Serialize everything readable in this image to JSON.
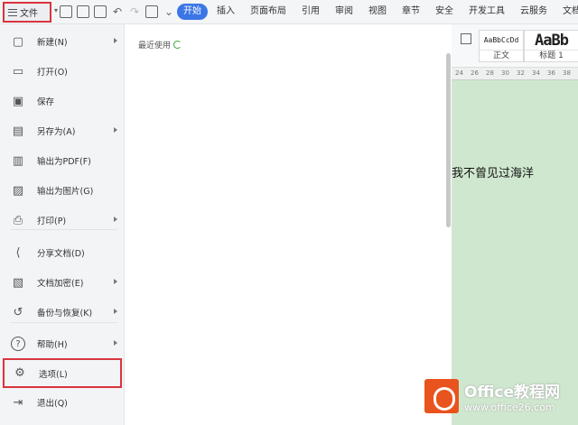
{
  "topbar": {
    "file_label": "文件",
    "tabs": [
      "开始",
      "插入",
      "页面布局",
      "引用",
      "审阅",
      "视图",
      "章节",
      "安全",
      "开发工具",
      "云服务",
      "文档助手"
    ]
  },
  "ribbon": {
    "styles": [
      {
        "sample": "AaBbCcDd",
        "label": "正文"
      },
      {
        "sample": "AaBb",
        "label": "标题 1"
      }
    ]
  },
  "ruler": {
    "ticks": [
      "24",
      "26",
      "28",
      "30",
      "32",
      "34",
      "36",
      "38"
    ]
  },
  "document": {
    "text": "我不曾见过海洋"
  },
  "menu": {
    "items": [
      {
        "label": "新建(N)",
        "icon": "new-file-icon",
        "arrow": true
      },
      {
        "label": "打开(O)",
        "icon": "folder-open-icon",
        "arrow": false
      },
      {
        "label": "保存",
        "icon": "save-icon",
        "arrow": false
      },
      {
        "label": "另存为(A)",
        "icon": "save-as-icon",
        "arrow": true
      },
      {
        "label": "输出为PDF(F)",
        "icon": "export-pdf-icon",
        "arrow": false
      },
      {
        "label": "输出为图片(G)",
        "icon": "export-image-icon",
        "arrow": false
      },
      {
        "label": "打印(P)",
        "icon": "printer-icon",
        "arrow": true
      },
      {
        "label": "分享文档(D)",
        "icon": "share-icon",
        "arrow": false
      },
      {
        "label": "文档加密(E)",
        "icon": "encrypt-icon",
        "arrow": true
      },
      {
        "label": "备份与恢复(K)",
        "icon": "backup-icon",
        "arrow": true
      },
      {
        "label": "帮助(H)",
        "icon": "help-icon",
        "arrow": true
      },
      {
        "label": "选项(L)",
        "icon": "gear-icon",
        "arrow": false
      },
      {
        "label": "退出(Q)",
        "icon": "exit-icon",
        "arrow": false
      }
    ]
  },
  "recent": {
    "title": "最近使用"
  },
  "watermark": {
    "brand": "Office教程网",
    "url": "www.office26.com"
  },
  "colors": {
    "accent": "#3b76e6",
    "highlight": "#d9343d",
    "doc_bg": "#cfe7cf"
  }
}
